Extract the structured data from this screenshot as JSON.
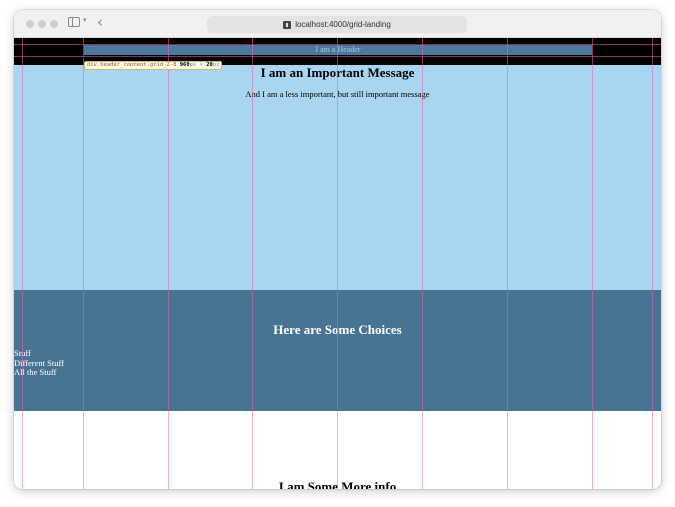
{
  "browser": {
    "url": "localhost:4000/grid-landing"
  },
  "inspector": {
    "selector": "div.header_content.grid_2-8",
    "width": "960",
    "height": "20",
    "unit": "px",
    "times": "×"
  },
  "page": {
    "header_text": "I am a Header",
    "hero": {
      "title": "I am an Important Message",
      "subtitle": "And I am a less important, but still important message"
    },
    "choices": {
      "title": "Here are Some Choices",
      "items": [
        "Stuff",
        "Different Stuff",
        "All the Stuff"
      ]
    },
    "more": {
      "title": "I am Some More info"
    }
  },
  "colors": {
    "header_band": "#000000",
    "header_content": "#4a7a9b",
    "hero_background": "#a8d5f1",
    "choices_background": "#487494",
    "grid_overlay": "#ec60aa"
  }
}
